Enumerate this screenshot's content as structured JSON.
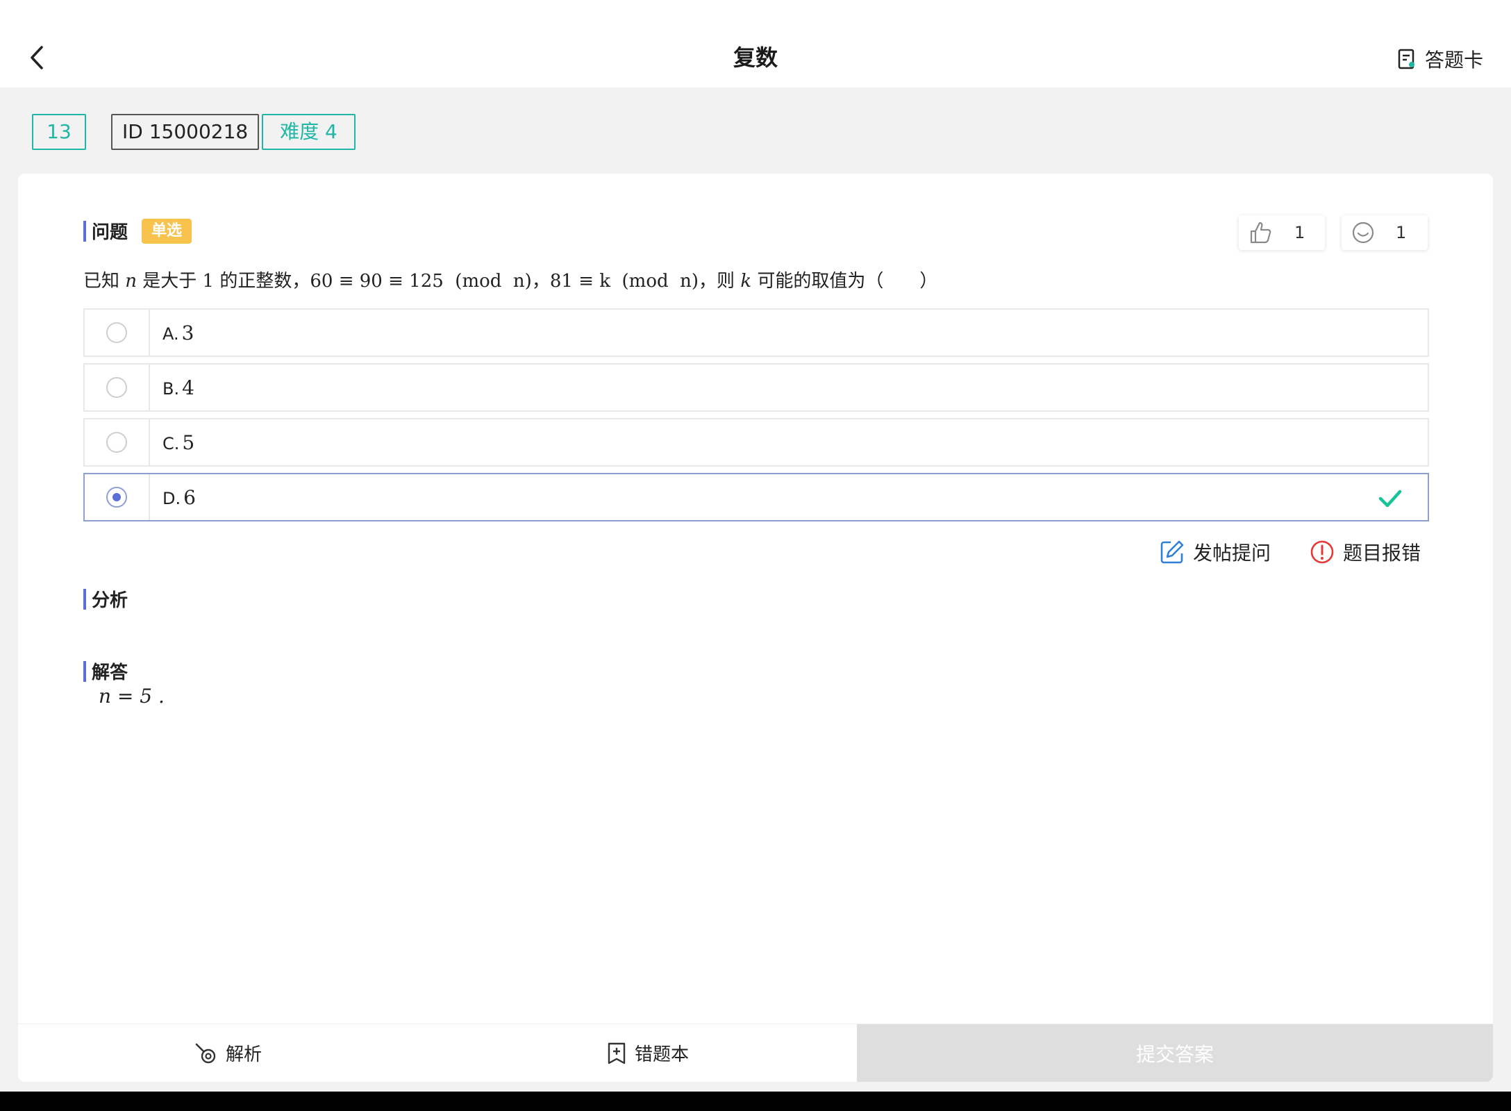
{
  "header": {
    "title": "复数",
    "answer_card_label": "答题卡"
  },
  "tags": {
    "number": "13",
    "id": "ID 15000218",
    "difficulty": "难度 4"
  },
  "question_section": {
    "label": "问题",
    "type_badge": "单选",
    "like_count": "1",
    "smile_count": "1"
  },
  "question": {
    "p1": "已知 ",
    "v1": "n",
    "p2": " 是大于 ",
    "v2": "1",
    "p3": " 的正整数，",
    "v3": "60 ≡ 90 ≡ 125  (mod  n)",
    "p4": "，",
    "v4": "81 ≡ k  (mod  n)",
    "p5": "，则 ",
    "v5": "k",
    "p6": " 可能的取值为（　　）"
  },
  "options": [
    {
      "letter": "A.",
      "value": "3",
      "selected": false
    },
    {
      "letter": "B.",
      "value": "4",
      "selected": false
    },
    {
      "letter": "C.",
      "value": "5",
      "selected": false
    },
    {
      "letter": "D.",
      "value": "6",
      "selected": true
    }
  ],
  "actions": {
    "ask_label": "发帖提问",
    "report_label": "题目报错"
  },
  "analysis": {
    "label": "分析"
  },
  "answer": {
    "label": "解答",
    "text": "n = 5 ."
  },
  "bottom": {
    "analysis_label": "解析",
    "mistake_label": "错题本",
    "submit_label": "提交答案"
  },
  "colors": {
    "accent_teal": "#1fb6a6",
    "accent_blue": "#5b6fd6",
    "badge_yellow": "#f7c34c",
    "check_green": "#19c39a",
    "report_red": "#e53935",
    "ask_blue": "#2f7fd8"
  }
}
